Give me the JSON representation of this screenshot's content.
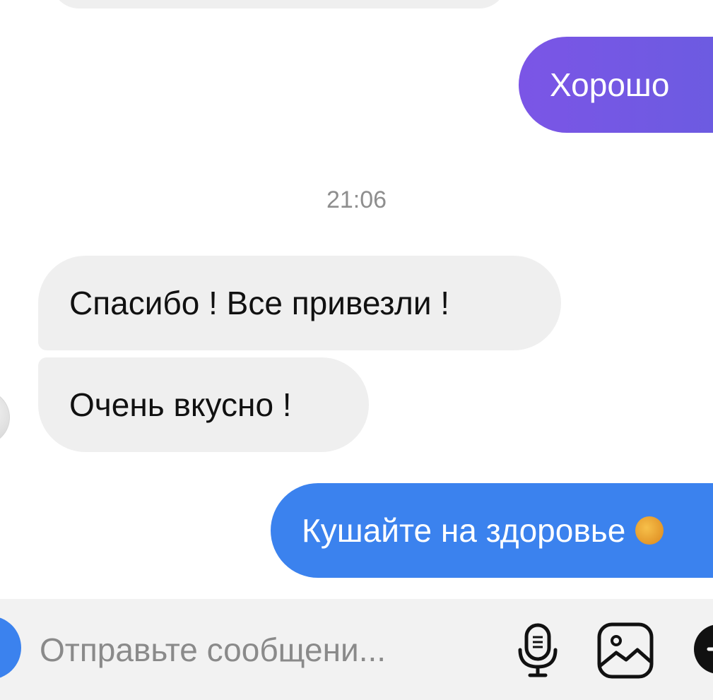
{
  "messages": {
    "outgoing_1": "Хорошо",
    "timestamp": "21:06",
    "incoming_1": "Спасибо ! Все привезли !",
    "incoming_2": "Очень вкусно !",
    "outgoing_2": "Кушайте на здоровье"
  },
  "composer": {
    "placeholder": "Отправьте сообщени...",
    "value": ""
  },
  "icons": {
    "camera": "camera-icon",
    "microphone": "microphone-icon",
    "gallery": "gallery-icon",
    "more": "plus-icon",
    "emoji": "emoji-icon"
  },
  "colors": {
    "outgoing_purple": "#7b55e6",
    "outgoing_blue": "#3b82ee",
    "incoming_gray": "#efefef",
    "timestamp_gray": "#8e8e8e"
  }
}
